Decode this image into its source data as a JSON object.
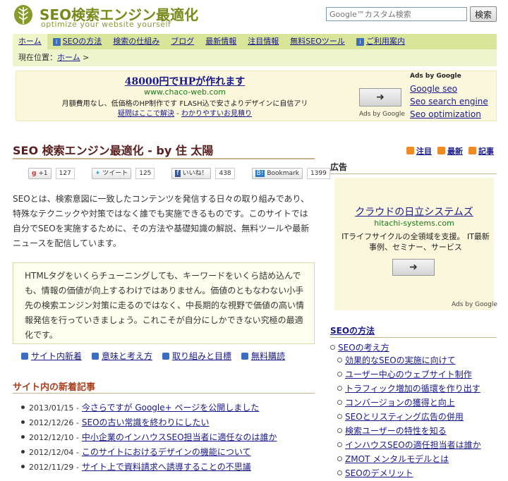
{
  "header": {
    "logo_title": "SEO検索エンジン最適化",
    "logo_sub": "optimize your website yourself",
    "search_placeholder": "Google™カスタム検索",
    "search_button": "検索"
  },
  "nav": {
    "items": [
      {
        "label": "ホーム"
      },
      {
        "label": "SEOの方法"
      },
      {
        "label": "検索の仕組み"
      },
      {
        "label": "ブログ"
      },
      {
        "label": "最新情報"
      },
      {
        "label": "注目情報"
      },
      {
        "label": "無料SEOツール"
      },
      {
        "label": "ご利用案内"
      }
    ]
  },
  "breadcrumb": {
    "prefix": "現在位置：",
    "home": "ホーム",
    "sep": " >"
  },
  "ad_top": {
    "title": "48000円でHPが作れます",
    "url": "www.chaco-web.com",
    "text": "月額費用なし、低価格のHP制作です FLASH込で安さよりデザインに自信アリ",
    "sub_link1": "疑問はここで解決",
    "sub_sep": " - ",
    "sub_link2": "わかりやすいお見積り",
    "by": "Ads by Google",
    "links_head": "Ads by Google",
    "links": [
      "Google seo",
      "Seo search engine",
      "Seo optimization"
    ]
  },
  "main": {
    "title": "SEO 検索エンジン最適化 - by 住 太陽",
    "feeds": [
      "注目",
      "最新",
      "記事"
    ],
    "social": {
      "gplus": "+1",
      "gplus_count": "127",
      "tweet": "ツイート",
      "tweet_count": "125",
      "like": "いいね！",
      "like_count": "438",
      "bookmark": "Bookmark",
      "bookmark_count": "1399"
    },
    "intro": "SEOとは、検索意図に一致したコンテンツを発信する日々の取り組みであり、特殊なテクニックや対策ではなく誰でも実施できるものです。このサイトでは自分でSEOを実施するために、その方法や基礎知識の解説、無料ツールや最新ニュースを配信しています。",
    "quote": "HTMLタグをいくらチューニングしても、キーワードをいくら詰め込んでも、情報の価値が向上するわけではありません。価値のともなわない小手先の検索エンジン対策に走るのではなく、中長期的な視野で価値の高い情報発信を行っていきましょう。これこそが自分にしかできない究極の最適化です。",
    "sub_links": [
      "サイト内新着",
      "意味と考え方",
      "取り組みと目標",
      "無料購読"
    ],
    "news_head": "サイト内の新着記事",
    "news": [
      {
        "date": "2013/01/15 -",
        "title": "今さらですが Google+ ページを公開しました"
      },
      {
        "date": "2012/12/26 -",
        "title": "SEOの古い常識を終わりにしたい"
      },
      {
        "date": "2012/12/10 -",
        "title": "中小企業のインハウスSEO担当者に適任なのは誰か"
      },
      {
        "date": "2012/12/04 -",
        "title": "このサイトにおけるデザインの機能について"
      },
      {
        "date": "2012/11/29 -",
        "title": "サイト上で資料請求へ誘導することの不思議"
      }
    ]
  },
  "sidebar": {
    "ad_head": "広告",
    "ad_title": "クラウドの日立システムズ",
    "ad_url": "hitachi-systems.com",
    "ad_text": "ITライフサイクルの全領域を支援。 IT最新事例、セミナー、サービス",
    "ad_by": "Ads by Google",
    "seo_head": "SEOの方法",
    "seo_root": "SEOの考え方",
    "seo_items": [
      "効果的なSEOの実施に向けて",
      "ユーザー中心のウェブサイト制作",
      "トラフィック増加の循環を作り出す",
      "コンバージョンの獲得と向上",
      "SEOとリスティング広告の併用",
      "検索ユーザーの特性を知る",
      "インハウスSEOの適任担当者は誰か",
      "ZMOT メンタルモデルとは",
      "SEOのデメリット"
    ]
  },
  "colors": {
    "nav_bg": "#d9e69a",
    "breadcrumb_bg": "#eef4cc",
    "ad_bg": "#fbf7dd",
    "title_color": "#5a2020",
    "link_color": "#1a1a8c",
    "logo_green": "#7a8a1a"
  }
}
